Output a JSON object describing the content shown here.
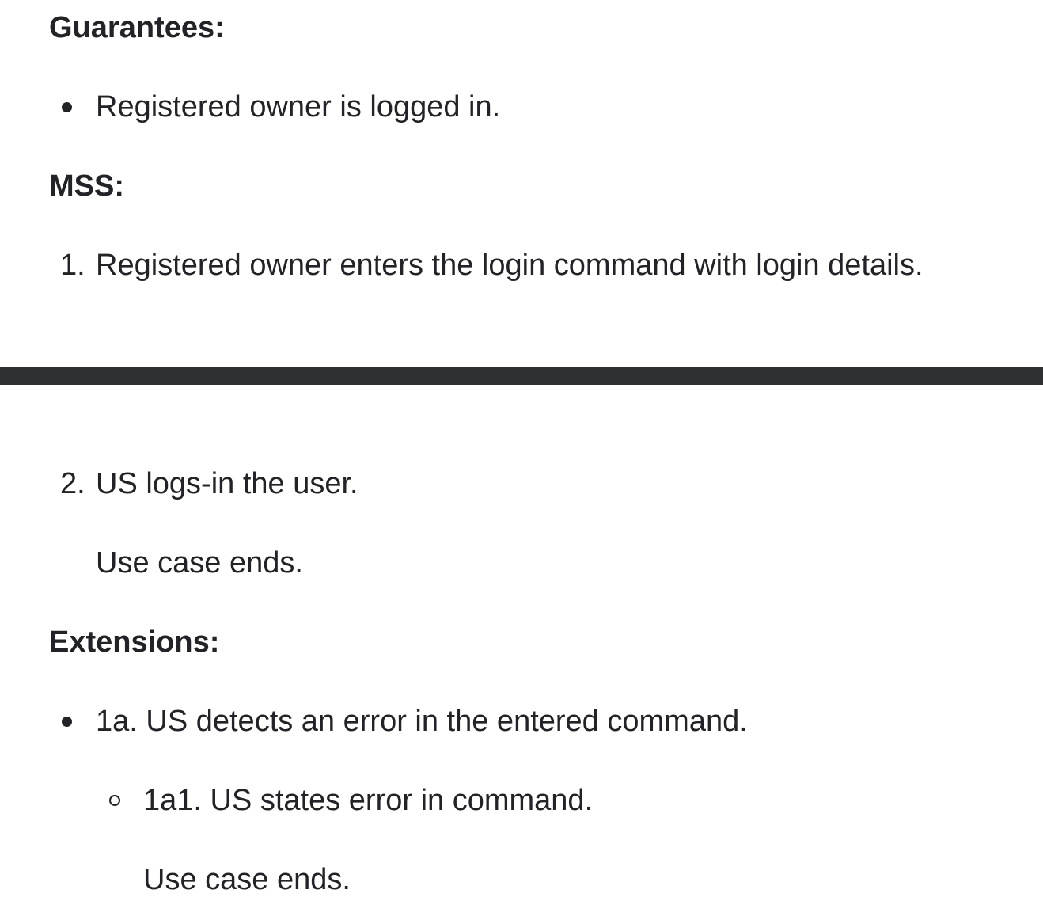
{
  "guarantees": {
    "heading": "Guarantees:",
    "items": [
      "Registered owner is logged in."
    ]
  },
  "mss": {
    "heading": "MSS:",
    "steps": [
      {
        "number": "1.",
        "text": "Registered owner enters the login command with login details."
      },
      {
        "number": "2.",
        "text": "US logs-in the user."
      }
    ],
    "end_note": "Use case ends."
  },
  "extensions": {
    "heading": "Extensions:",
    "items": [
      {
        "text": "1a. US detects an error in the entered command.",
        "subitems": [
          {
            "text": "1a1. US states error in command.",
            "end_note": "Use case ends."
          }
        ]
      }
    ]
  }
}
